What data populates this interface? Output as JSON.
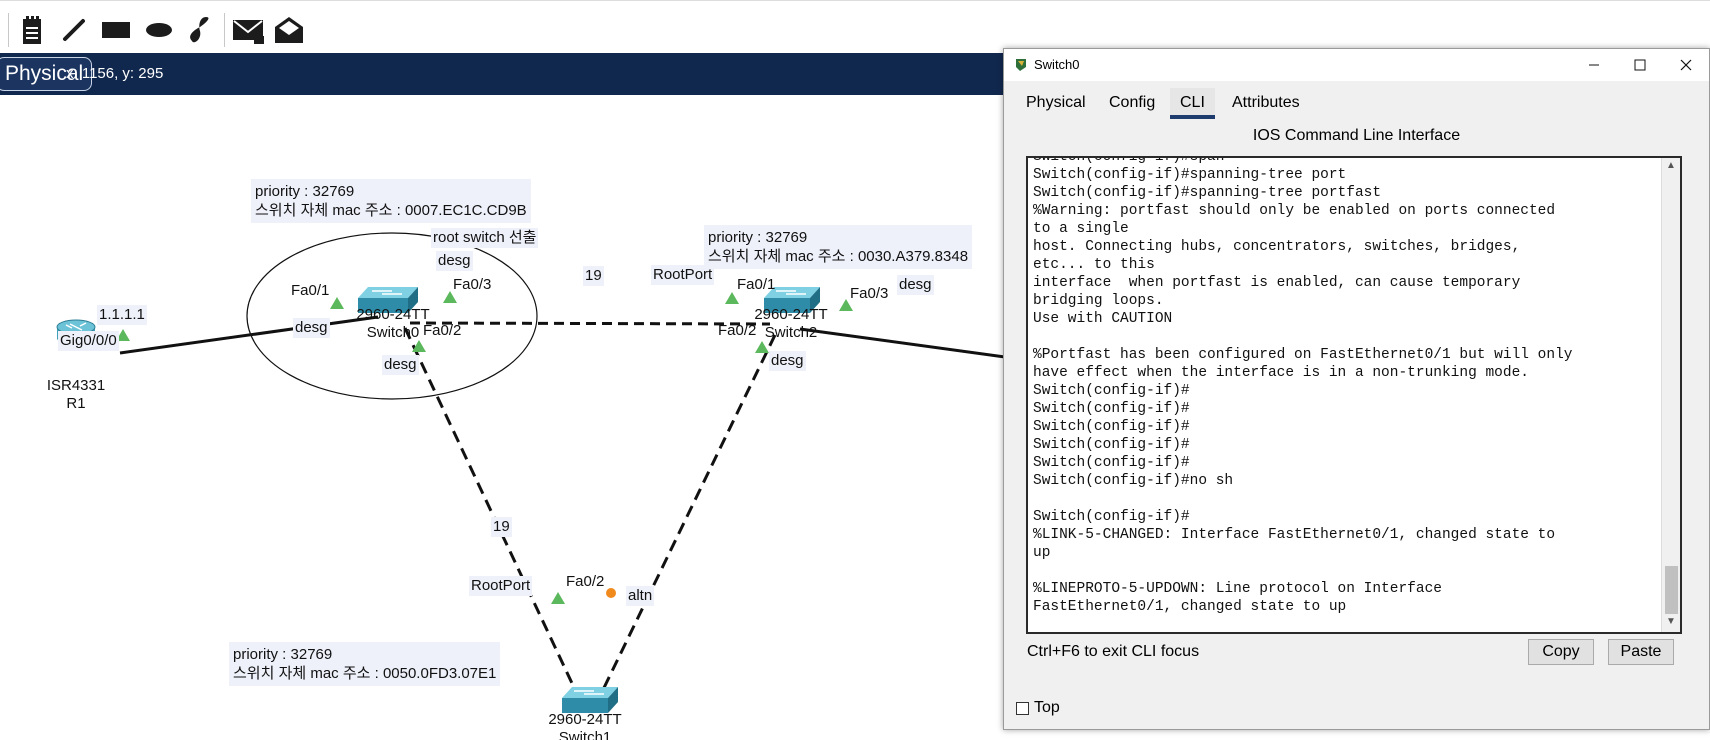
{
  "toolbar": {
    "icons": [
      "note-icon",
      "line-icon",
      "rectangle-icon",
      "ellipse-icon",
      "freeform-icon",
      "add-simple-pdu-icon",
      "add-complex-pdu-icon"
    ]
  },
  "workspace": {
    "mode_tab": "Physical",
    "coords": "x: 1156, y: 295"
  },
  "topology": {
    "r1": {
      "model": "ISR4331",
      "name": "R1",
      "port": "Gig0/0/0",
      "ip": "1.1.1.1"
    },
    "switch0": {
      "model": "2960-24TT",
      "name": "Switch0",
      "priority": "priority : 32769",
      "mac": "스위치 자체 mac 주소 : 0007.EC1C.CD9B",
      "note": "root switch 선출",
      "ports": {
        "fa01": "Fa0/1",
        "fa02": "Fa0/2",
        "fa03": "Fa0/3"
      },
      "roles": {
        "desg_top": "desg",
        "desg_left": "desg",
        "desg_bottom": "desg"
      }
    },
    "switch2": {
      "model": "2960-24TT",
      "name": "Switch2",
      "priority": "priority : 32769",
      "mac": "스위치 자체 mac 주소 : 0030.A379.8348",
      "ports": {
        "fa01": "Fa0/1",
        "fa02": "Fa0/2",
        "fa03": "Fa0/3"
      },
      "roles": {
        "root": "RootPort",
        "desg_right": "desg",
        "desg_bottom": "desg"
      }
    },
    "switch1": {
      "model": "2960-24TT",
      "name": "Switch1",
      "priority": "priority : 32769",
      "mac": "스위치 자체 mac 주소 : 0050.0FD3.07E1",
      "ports": {
        "fa02": "Fa0/2"
      },
      "roles": {
        "root": "RootPort",
        "altn": "altn"
      }
    },
    "costs": {
      "sw0_sw2": "19",
      "sw0_sw1": "19"
    },
    "colors": {
      "link_up": "#5cb85c",
      "blocked": "#f08a1c",
      "link": "#111111"
    }
  },
  "window": {
    "title": "Switch0",
    "tabs": [
      {
        "label": "Physical",
        "active": false
      },
      {
        "label": "Config",
        "active": false
      },
      {
        "label": "CLI",
        "active": true
      },
      {
        "label": "Attributes",
        "active": false
      }
    ],
    "cli_heading": "IOS Command Line Interface",
    "cli_output": "Switch(config-if)#span\nSwitch(config-if)#spanning-tree port\nSwitch(config-if)#spanning-tree portfast\n%Warning: portfast should only be enabled on ports connected\nto a single\nhost. Connecting hubs, concentrators, switches, bridges,\netc... to this\ninterface  when portfast is enabled, can cause temporary\nbridging loops.\nUse with CAUTION\n\n%Portfast has been configured on FastEthernet0/1 but will only\nhave effect when the interface is in a non-trunking mode.\nSwitch(config-if)#\nSwitch(config-if)#\nSwitch(config-if)#\nSwitch(config-if)#\nSwitch(config-if)#\nSwitch(config-if)#no sh\n\nSwitch(config-if)#\n%LINK-5-CHANGED: Interface FastEthernet0/1, changed state to\nup\n\n%LINEPROTO-5-UPDOWN: Line protocol on Interface\nFastEthernet0/1, changed state to up\n",
    "hint": "Ctrl+F6 to exit CLI focus",
    "copy_label": "Copy",
    "paste_label": "Paste",
    "top_label": "Top",
    "top_checked": false
  }
}
